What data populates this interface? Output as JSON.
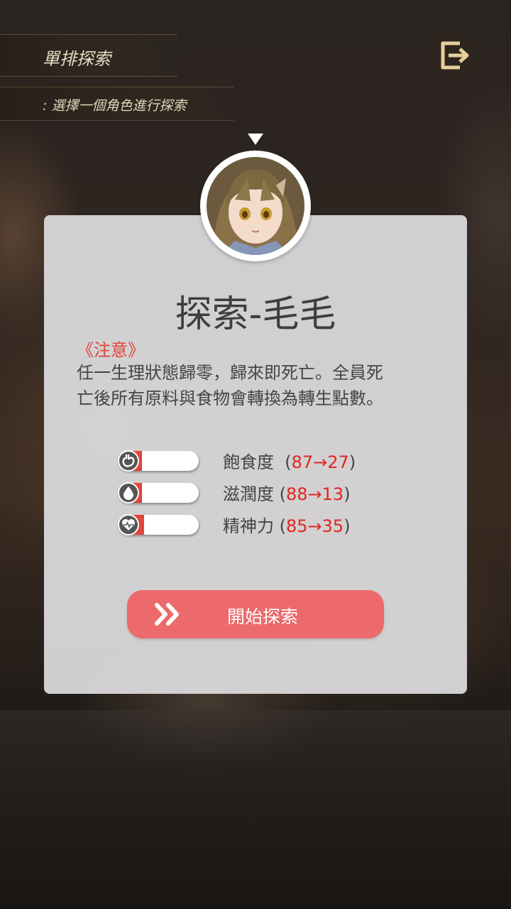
{
  "header": {
    "title": "單排探索",
    "subtitle": ": 選擇一個角色進行探索",
    "exit_icon": "exit-door-icon"
  },
  "character": {
    "avatar_icon": "character-portrait",
    "title": "探索-毛毛"
  },
  "notice": {
    "label": "《注意》",
    "line1": "任一生理狀態歸零，歸來即死亡。全員死",
    "line2": "亡後所有原料與食物會轉換為轉生點數。"
  },
  "stats": [
    {
      "icon": "stomach-icon",
      "name": "飽食度",
      "sep": "  (",
      "from": "87",
      "arrow": "→",
      "to": "27",
      "close": ")",
      "level": 0.02
    },
    {
      "icon": "water-drop-icon",
      "name": "滋潤度",
      "sep": " (",
      "from": "88",
      "arrow": "→",
      "to": "13",
      "close": ")",
      "level": 0.02
    },
    {
      "icon": "heart-icon",
      "name": "精神力",
      "sep": " (",
      "from": "85",
      "arrow": "→",
      "to": "35",
      "close": ")",
      "level": 0.06
    }
  ],
  "start_button": {
    "label": "開始探索",
    "icon": "double-chevron-right-icon"
  },
  "colors": {
    "accent_red": "#e0453d",
    "button_pink": "#ec6a6b",
    "gold": "#e7cf9c"
  }
}
